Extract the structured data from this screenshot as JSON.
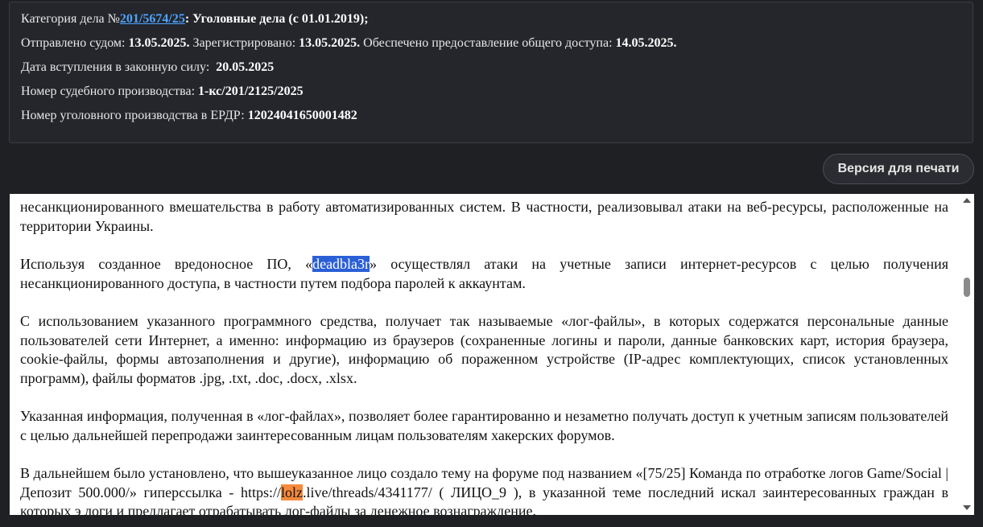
{
  "info": {
    "category_label": "Категория дела №",
    "case_number": "201/5674/25",
    "category_value": ": Уголовные дела (с 01.01.2019);",
    "sent_label": "Отправлено судом:",
    "sent_value": "13.05.2025.",
    "registered_label": "Зарегистрировано:",
    "registered_value": "13.05.2025.",
    "access_label": "Обеспечено предоставление общего доступа:",
    "access_value": "14.05.2025.",
    "effective_label": "Дата вступления в законную силу:",
    "effective_value": "20.05.2025",
    "court_proc_label": "Номер судебного производства:",
    "court_proc_value": "1-кс/201/2125/2025",
    "erdr_label": "Номер уголовного производства в ЕРДР:",
    "erdr_value": "12024041650001482"
  },
  "print_button": "Версия для печати",
  "document": {
    "p0": "несанкционированного вмешательства в работу автоматизированных систем. В частности, реализовывал атаки на веб-ресурсы, расположенные на территории Украины.",
    "p1_before": "Используя созданное вредоносное ПО, «",
    "p1_selected": "deadbla3r",
    "p1_after": "» осуществлял атаки на учетные записи интернет-ресурсов с целью получения несанкционированного доступа, в частности путем подбора паролей к аккаунтам.",
    "p2": "С использованием указанного программного средства, получает так называемые «лог-файлы», в которых содержатся персональные данные пользователей сети Интернет, а именно: информацию из браузеров (сохраненные логины и пароли, данные банковских карт, история браузера, cookie-файлы, формы автозаполнения и другие), информацию об пораженном устройстве (IP-адрес комплектующих, список установленных программ), файлы форматов .jpg, .txt, .doc, .docx, .xlsx.",
    "p3": "Указанная информация, полученная в «лог-файлах», позволяет более гарантированно и незаметно получать доступ к учетным записям пользователей с целью дальнейшей перепродажи заинтересованным лицам пользователям хакерских форумов.",
    "p4_before": "В дальнейшем было установлено, что вышеуказанное лицо создало тему на форуме под названием «[75/25] Команда по отработке логов Game/Social | Депозит 500.000/» гиперссылка - https://",
    "p4_highlight": "lolz",
    "p4_after": ".live/threads/4341177/ ( ЛИЦО_9 ), в указанной теме последний искал заинтересованных граждан в которых э логи и предлагает отрабатывать лог-файлы за денежное вознаграждение."
  }
}
